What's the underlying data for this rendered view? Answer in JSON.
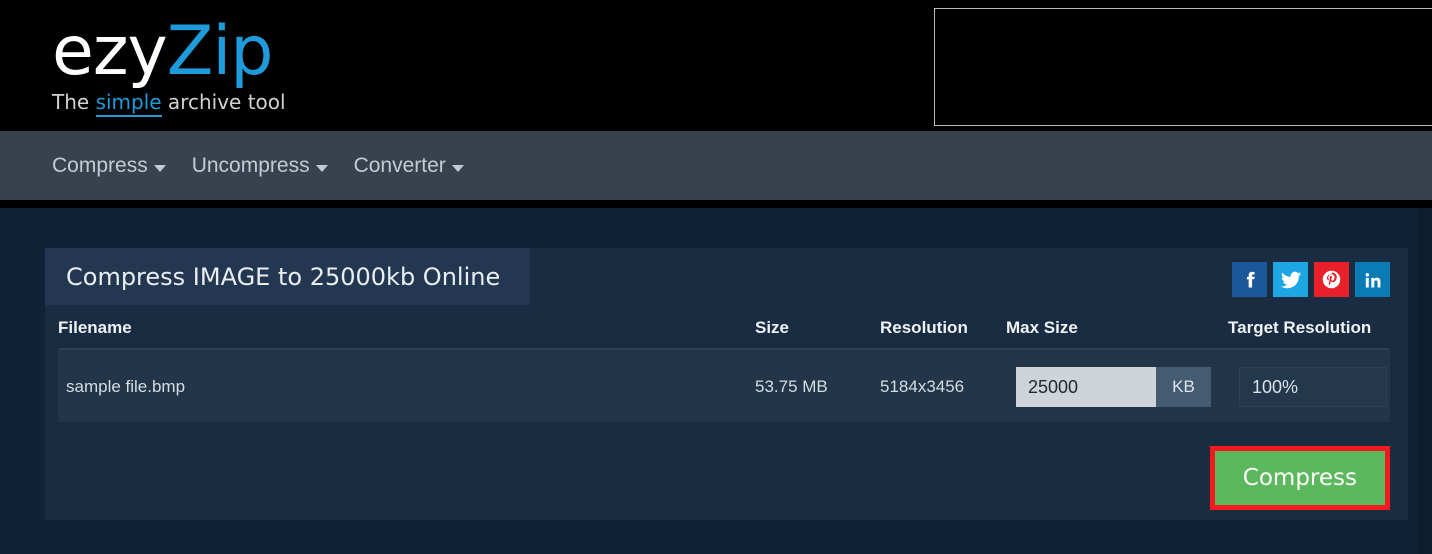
{
  "header": {
    "logo": {
      "part1": "ezy",
      "part2": "Zip"
    },
    "tagline": {
      "before": "The ",
      "highlight": "simple",
      "after": " archive tool"
    },
    "ad_slot_label": ""
  },
  "nav": {
    "items": [
      {
        "label": "Compress",
        "icon": "chevron-down-icon"
      },
      {
        "label": "Uncompress",
        "icon": "chevron-down-icon"
      },
      {
        "label": "Converter",
        "icon": "chevron-down-icon"
      }
    ]
  },
  "card": {
    "title": "Compress IMAGE to 25000kb Online",
    "social": [
      {
        "name": "facebook",
        "label": "f",
        "color": "#1c5799"
      },
      {
        "name": "twitter",
        "label": "t",
        "color": "#1ca7e4"
      },
      {
        "name": "pinterest",
        "label": "P",
        "color": "#e8202a"
      },
      {
        "name": "linkedin",
        "label": "in",
        "color": "#0b7bb5"
      }
    ],
    "table": {
      "headers": {
        "filename": "Filename",
        "size": "Size",
        "resolution": "Resolution",
        "max_size": "Max Size",
        "target_resolution": "Target Resolution"
      },
      "rows": [
        {
          "filename": "sample file.bmp",
          "size": "53.75 MB",
          "resolution": "5184x3456",
          "max_size_value": "25000",
          "max_size_unit": "KB",
          "target_resolution_value": "100%"
        }
      ]
    },
    "actions": {
      "compress_label": "Compress",
      "compress_button_color": "#5cb85c",
      "compress_highlight_color": "#f21a1a"
    }
  }
}
